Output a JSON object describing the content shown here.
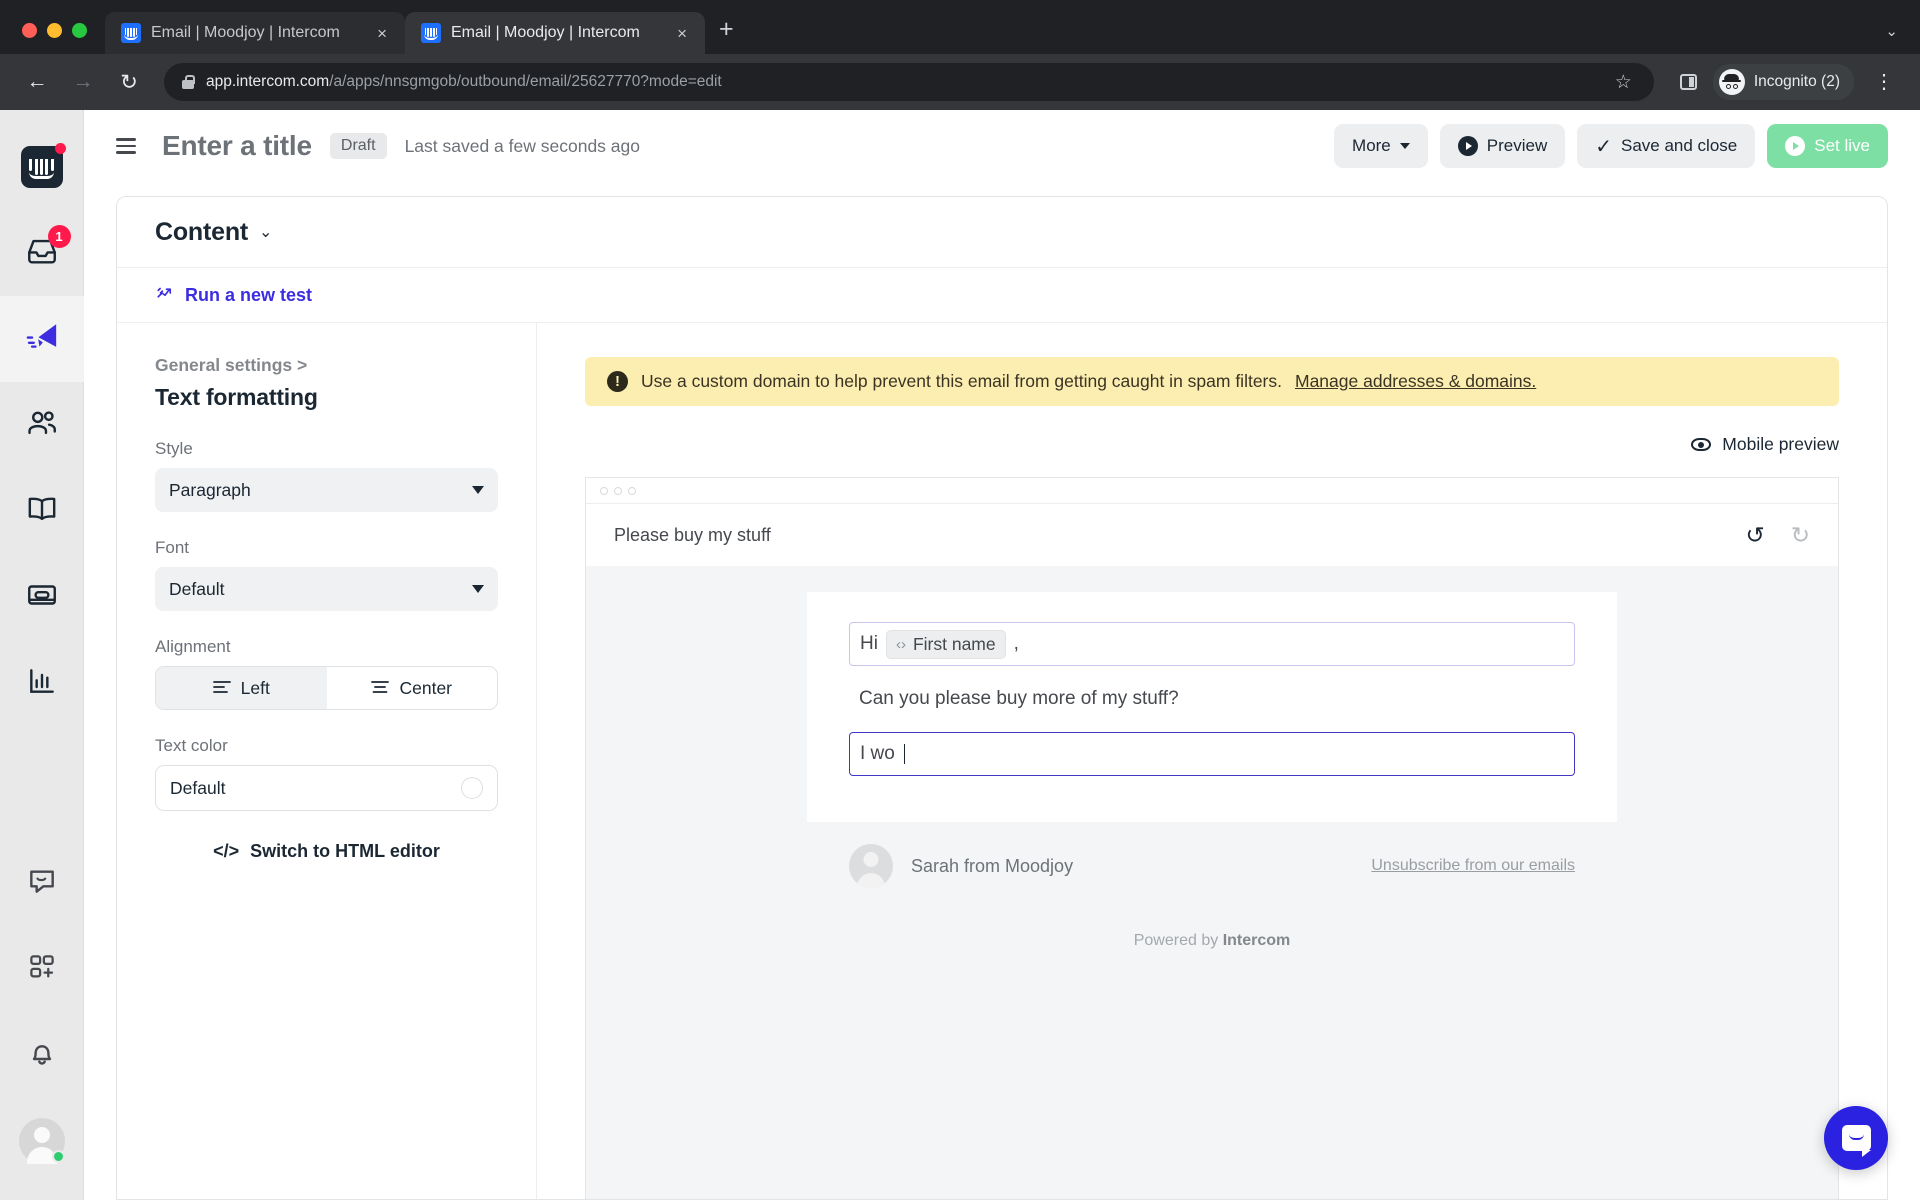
{
  "browser": {
    "tabs": [
      {
        "title": "Email | Moodjoy | Intercom",
        "active": false
      },
      {
        "title": "Email | Moodjoy | Intercom",
        "active": true
      }
    ],
    "new_tab_label": "+",
    "tab_close_label": "×",
    "tablist_chevron": "⌄",
    "back_label": "←",
    "forward_label": "→",
    "reload_label": "↻",
    "url_domain": "app.intercom.com",
    "url_path": "/a/apps/nnsgmgob/outbound/email/25627770?mode=edit",
    "star_label": "☆",
    "profile_label": "Incognito (2)",
    "menu_label": "⋮"
  },
  "rail": {
    "logo_name": "intercom-logo",
    "inbox_badge": "1",
    "items": [
      {
        "name": "sidebar-item-inbox",
        "icon": "inbox-icon"
      },
      {
        "name": "sidebar-item-outbound",
        "icon": "paper-plane-icon",
        "active": true
      },
      {
        "name": "sidebar-item-contacts",
        "icon": "people-icon"
      },
      {
        "name": "sidebar-item-articles",
        "icon": "book-icon"
      },
      {
        "name": "sidebar-item-tickets",
        "icon": "card-icon"
      },
      {
        "name": "sidebar-item-reports",
        "icon": "bar-chart-icon"
      }
    ],
    "bottom_items": [
      {
        "name": "sidebar-item-messenger",
        "icon": "chat-bubble-icon"
      },
      {
        "name": "sidebar-item-apps",
        "icon": "apps-plus-icon"
      },
      {
        "name": "sidebar-item-notifications",
        "icon": "bell-icon"
      }
    ]
  },
  "topbar": {
    "menu_icon": "hamburger-icon",
    "title": "Enter a title",
    "status_pill": "Draft",
    "saved_text": "Last saved a few seconds ago",
    "more_label": "More",
    "preview_label": "Preview",
    "save_close_label": "Save and close",
    "set_live_label": "Set live"
  },
  "content_card": {
    "heading": "Content",
    "heading_chevron": "⌄",
    "run_test_label": "Run a new test",
    "run_test_icon": "ab-test-icon"
  },
  "settings": {
    "breadcrumb": "General settings >",
    "section_title": "Text formatting",
    "style": {
      "label": "Style",
      "value": "Paragraph"
    },
    "font": {
      "label": "Font",
      "value": "Default"
    },
    "alignment": {
      "label": "Alignment",
      "options": [
        {
          "label": "Left",
          "selected": true
        },
        {
          "label": "Center",
          "selected": false
        }
      ]
    },
    "text_color": {
      "label": "Text color",
      "value": "Default",
      "swatch_hex": "#ffffff"
    },
    "html_editor_label": "Switch to HTML editor"
  },
  "preview": {
    "warning": {
      "text": "Use a custom domain to help prevent this email from getting caught in spam filters.",
      "link": "Manage addresses & domains.",
      "bg_hex": "#fbeeb0"
    },
    "mobile_preview_label": "Mobile preview",
    "email": {
      "subject": "Please buy my stuff",
      "undo_label": "↺",
      "redo_label": "↻",
      "greeting_prefix": "Hi",
      "greeting_chip": "First name",
      "greeting_chip_icon": "‹›",
      "greeting_suffix": ",",
      "body_line": "Can you please buy more of my stuff?",
      "editing_line": "I wo",
      "sender_name": "Sarah from Moodjoy",
      "unsubscribe": "Unsubscribe from our emails",
      "powered_prefix": "Powered by",
      "powered_brand": "Intercom"
    }
  },
  "messenger": {
    "name": "intercom-messenger-launcher",
    "brand_hex": "#2a22e0"
  }
}
